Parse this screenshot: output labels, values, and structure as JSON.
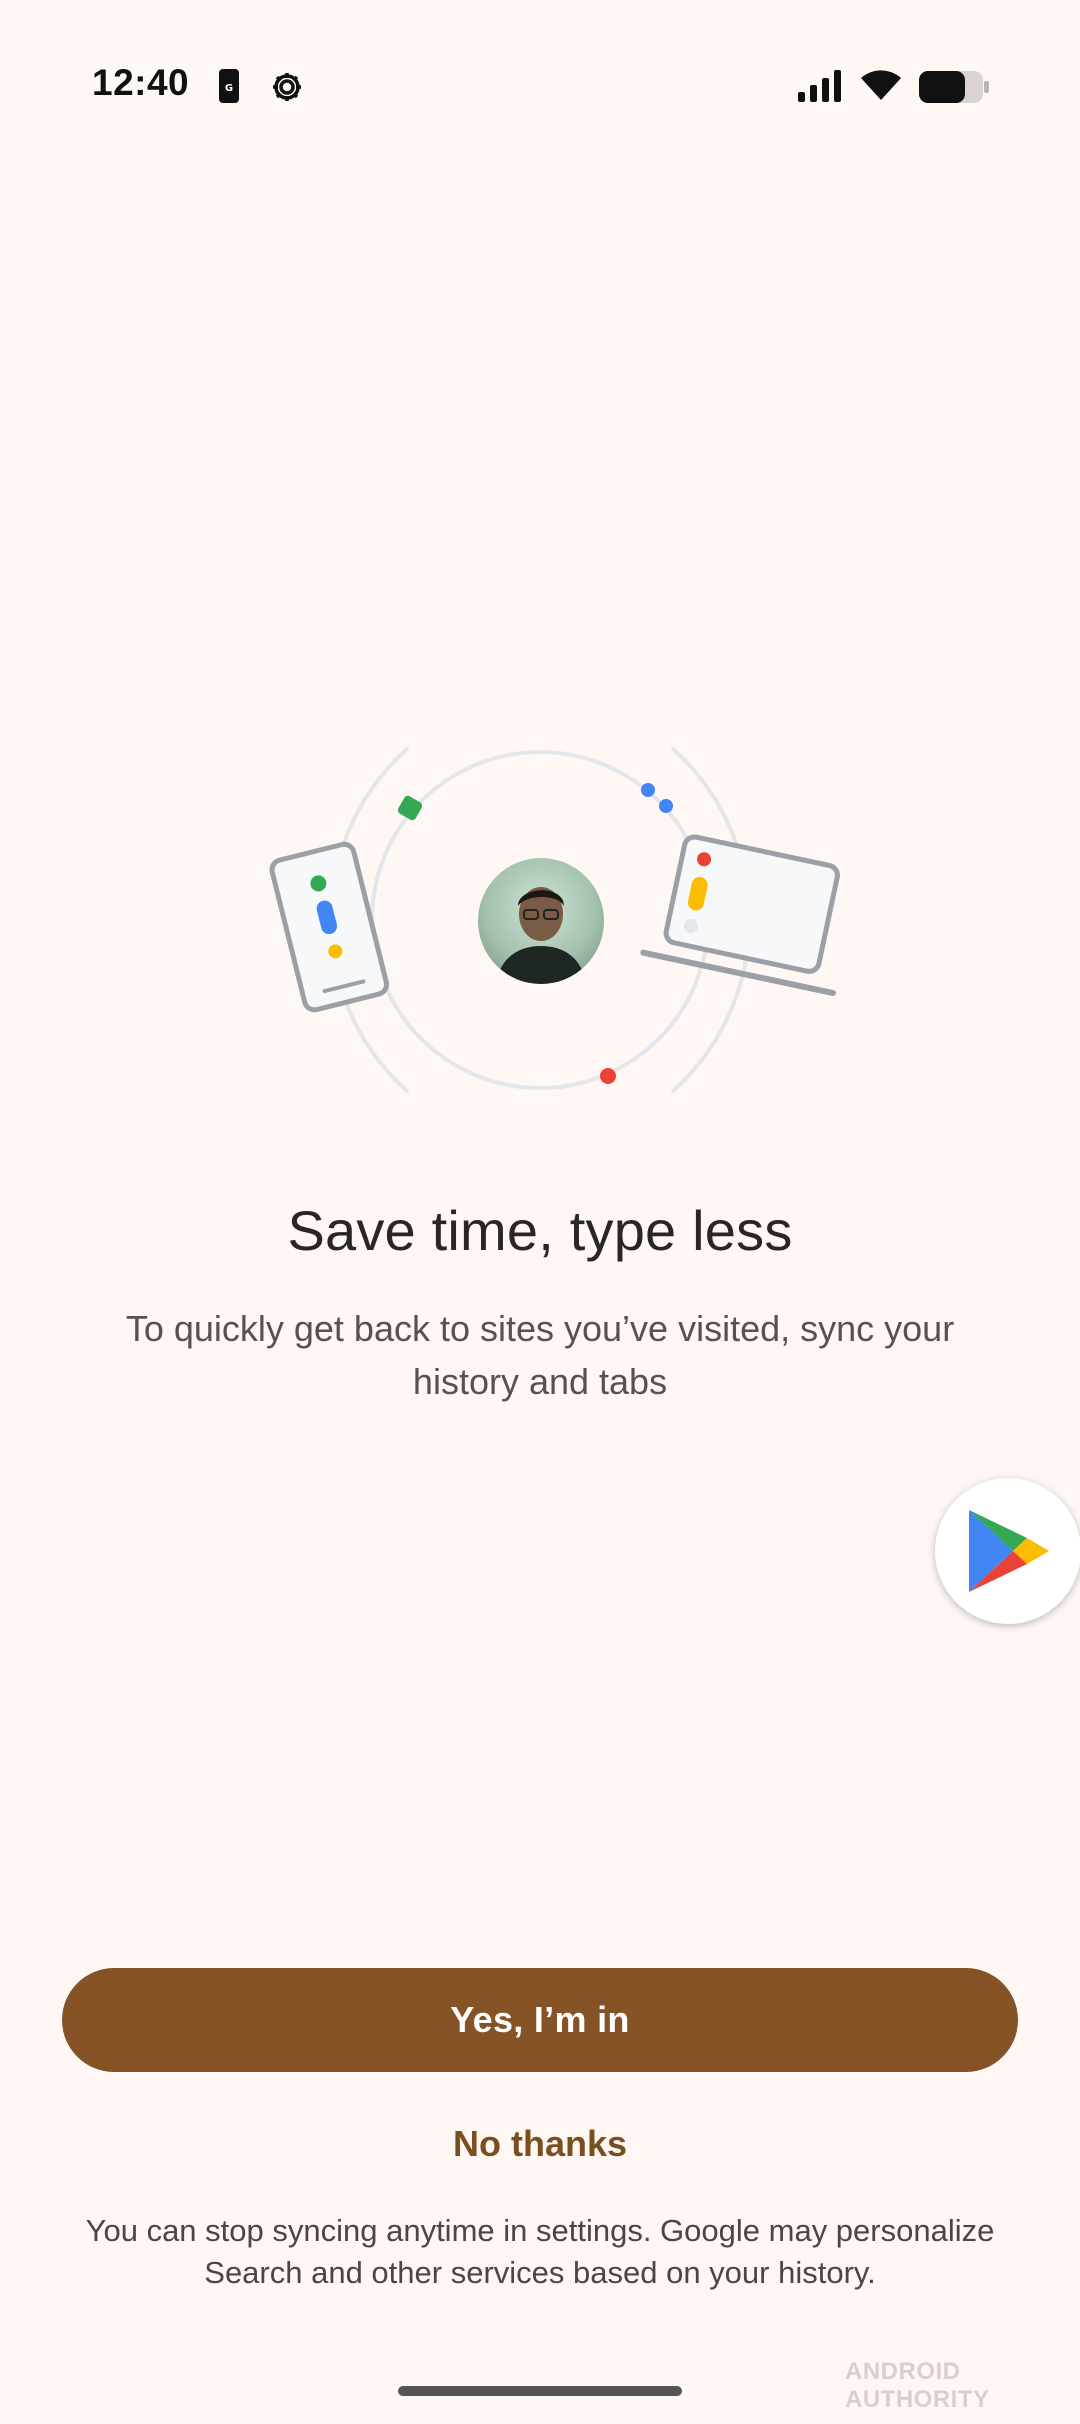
{
  "status_bar": {
    "time": "12:40",
    "icons": [
      "g-note-icon",
      "gear-icon",
      "signal-icon",
      "wifi-icon",
      "battery-icon"
    ]
  },
  "illustration": {
    "icons": [
      "phone-icon",
      "laptop-icon",
      "profile-avatar"
    ],
    "colors": {
      "green": "#34a853",
      "blue": "#4285f4",
      "yellow": "#fbbc04",
      "red": "#ea4335",
      "outline": "#9aa0a6",
      "orbit": "#e3e6ea"
    }
  },
  "main": {
    "headline": "Save time, type less",
    "subtext": "To quickly get back to sites you’ve visited, sync your history and tabs"
  },
  "floating_bubble": {
    "icon": "play-store-icon"
  },
  "actions": {
    "primary_label": "Yes, I’m in",
    "secondary_label": "No thanks"
  },
  "disclaimer": "You can stop syncing anytime in settings. Google may personalize Search and other services based on your history.",
  "watermark": "ANDROID AUTHORITY",
  "colors": {
    "background": "#fff7f4",
    "primary": "#855325",
    "secondary_text": "#7a4f1f"
  }
}
